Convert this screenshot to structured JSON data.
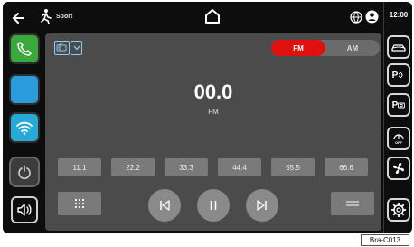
{
  "topbar": {
    "drive_mode_label": "Sport",
    "clock": "12:00"
  },
  "radio": {
    "bands": [
      "FM",
      "AM"
    ],
    "active_band": "FM",
    "frequency": "00.0",
    "unit": "FM",
    "presets": [
      "11.1",
      "22.2",
      "33.3",
      "44.4",
      "55.5",
      "66.6"
    ]
  },
  "right_buttons": {
    "p1_label": "P",
    "p2_label": "P",
    "off_label": "OFF"
  },
  "caption": "Bra-C013",
  "colors": {
    "accent_active": "#e01010",
    "phone_green": "#3aa83a",
    "blue_tile": "#2a9bdc",
    "wifi_tile": "#29a9d8",
    "panel_gray": "#4b4b4b"
  }
}
